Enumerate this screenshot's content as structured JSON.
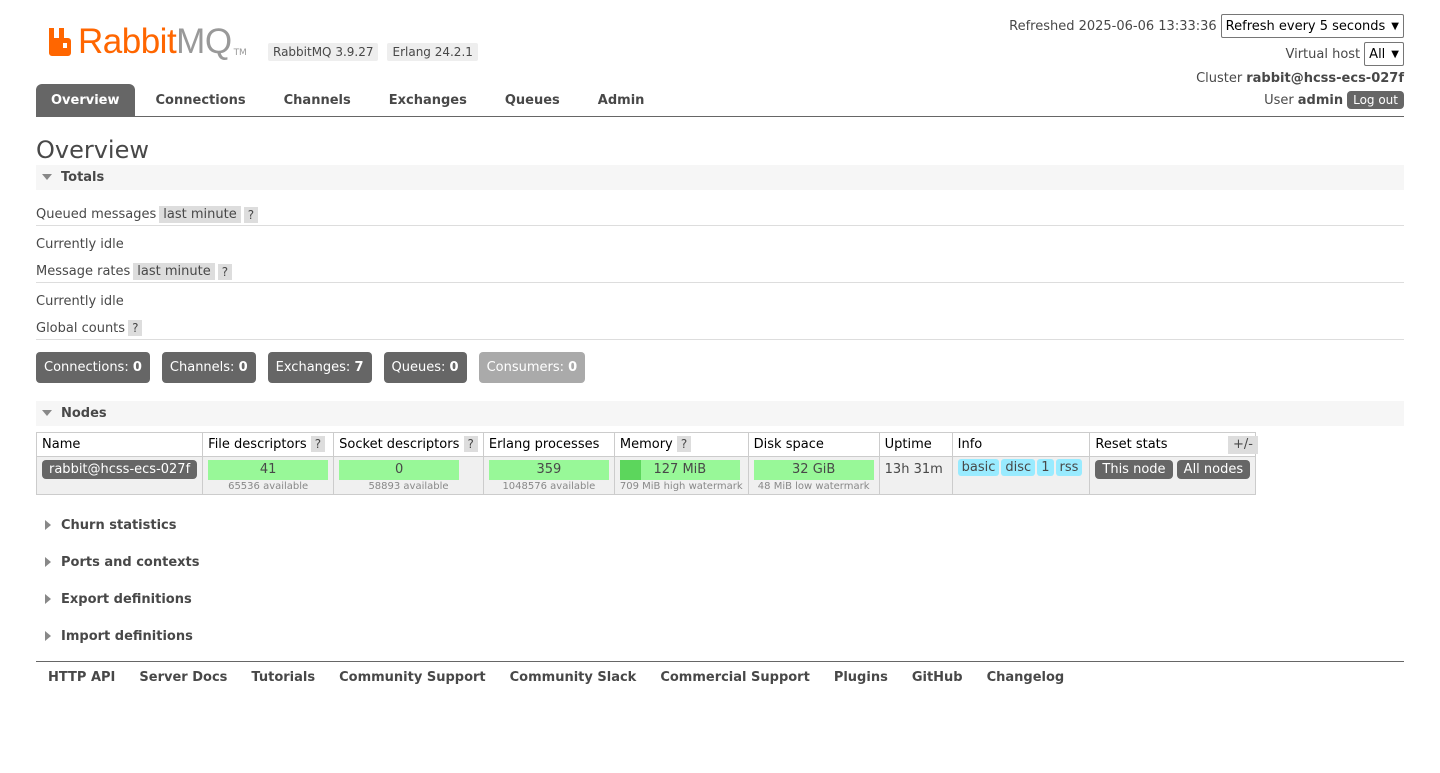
{
  "header": {
    "logo_rabbit": "Rabbit",
    "logo_mq": "MQ",
    "logo_tm": "TM",
    "rabbitmq_version": "RabbitMQ 3.9.27",
    "erlang_version": "Erlang 24.2.1",
    "refreshed_label": "Refreshed 2025-06-06 13:33:36",
    "refresh_select": "Refresh every 5 seconds",
    "vhost_label": "Virtual host",
    "vhost_select": "All",
    "cluster_label": "Cluster",
    "cluster_name": "rabbit@hcss-ecs-027f",
    "user_label": "User",
    "user_name": "admin",
    "logout": "Log out"
  },
  "tabs": [
    {
      "label": "Overview",
      "active": true
    },
    {
      "label": "Connections"
    },
    {
      "label": "Channels"
    },
    {
      "label": "Exchanges"
    },
    {
      "label": "Queues"
    },
    {
      "label": "Admin"
    }
  ],
  "page_title": "Overview",
  "totals": {
    "title": "Totals",
    "queued_label": "Queued messages",
    "queued_range": "last minute",
    "help": "?",
    "queued_state": "Currently idle",
    "rates_label": "Message rates",
    "rates_range": "last minute",
    "rates_state": "Currently idle",
    "global_label": "Global counts",
    "counts": [
      {
        "label": "Connections:",
        "value": "0"
      },
      {
        "label": "Channels:",
        "value": "0"
      },
      {
        "label": "Exchanges:",
        "value": "7"
      },
      {
        "label": "Queues:",
        "value": "0"
      },
      {
        "label": "Consumers:",
        "value": "0"
      }
    ]
  },
  "nodes": {
    "title": "Nodes",
    "columns": {
      "name": "Name",
      "fd": "File descriptors",
      "sd": "Socket descriptors",
      "ep": "Erlang processes",
      "mem": "Memory",
      "disk": "Disk space",
      "uptime": "Uptime",
      "info": "Info",
      "reset": "Reset stats"
    },
    "toggle": "+/-",
    "row": {
      "name": "rabbit@hcss-ecs-027f",
      "fd_value": "41",
      "fd_sub": "65536 available",
      "sd_value": "0",
      "sd_sub": "58893 available",
      "ep_value": "359",
      "ep_sub": "1048576 available",
      "mem_value": "127 MiB",
      "mem_sub": "709 MiB high watermark",
      "mem_fill_fraction": 0.18,
      "disk_value": "32 GiB",
      "disk_sub": "48 MiB low watermark",
      "uptime": "13h 31m",
      "info_tags": [
        "basic",
        "disc",
        "1",
        "rss"
      ],
      "reset_this": "This node",
      "reset_all": "All nodes"
    }
  },
  "collapsed_sections": [
    "Churn statistics",
    "Ports and contexts",
    "Export definitions",
    "Import definitions"
  ],
  "footer": [
    "HTTP API",
    "Server Docs",
    "Tutorials",
    "Community Support",
    "Community Slack",
    "Commercial Support",
    "Plugins",
    "GitHub",
    "Changelog"
  ],
  "colors": {
    "brand": "#ff6600",
    "tab_active": "#666666",
    "bar": "#98f898",
    "tag": "#99ebff"
  }
}
